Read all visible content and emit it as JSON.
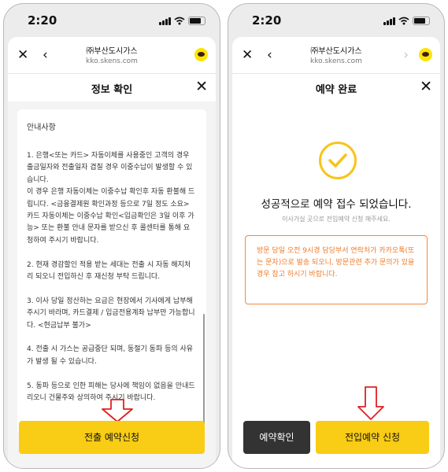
{
  "status_bar": {
    "time": "2:20"
  },
  "browser": {
    "site_name": "㈜부산도시가스",
    "site_url": "kko.skens.com"
  },
  "left_screen": {
    "dialog_title": "정보 확인",
    "notice_title": "안내사항",
    "notice_items": [
      "1. 은행<또는 카드> 자동이체를 사용중인 고객의 경우 출금일자와 전출일자 겹칠 경우 이중수납이 발생할 수 있습니다.\n이 경우 은행 자동이체는 이중수납 확인후 자동 환불해 드립니다. <금융결제원 확인과정 등으로 7일 정도 소요> 카드 자동이체는 이중수납 확인<입금확인은 3일 이후 가능> 또는 환불 안내 문자를 받으신 후 콜센터를 통해 요청하여 주시기 바랍니다.",
      "2. 현재 경감할인 적용 받는 세대는 전출 시 자동 해지처리 되오니 전입하신 후 재신청 부탁 드립니다.",
      "3. 이사 당일 정산하는 요금은 현장에서 기사에게 납부해 주시기 바라며, 카드결제 / 입금전용계좌 납부만 가능합니다. <현금납부 불가>",
      "4. 전출 시 가스는 공급중단 되며, 동절기 동파 등의 사유가 발생 될 수 있습니다.",
      "5. 동파 등으로 인한 피해는 당사에 책임이 없음을 안내드리오니 건물주와 상의하여 주시기 바랍니다."
    ],
    "primary_button": "전출 예약신청"
  },
  "right_screen": {
    "dialog_title": "예약 완료",
    "success_title": "성공적으로 예약 접수 되었습니다.",
    "success_subtitle": "이사가실 곳으로 전입예약 신청 해주세요.",
    "warning_text": "방문 당일 오전 9시경 담당부서 연락처가 카카오톡(또는 문자)으로 발송 되오니, 방문관련 추가 문의가 있을 경우 참고 하시기 바랍니다.",
    "secondary_button": "예약확인",
    "primary_button": "전입예약 신청"
  },
  "colors": {
    "accent_yellow": "#f9cc15",
    "warning_orange": "#ef7a26",
    "annotation_red": "#e02020",
    "dark_button": "#333333"
  },
  "icons": [
    "close-icon",
    "back-icon",
    "forward-icon",
    "kakao-talk-icon",
    "checkmark-icon",
    "down-arrow-annotation"
  ]
}
